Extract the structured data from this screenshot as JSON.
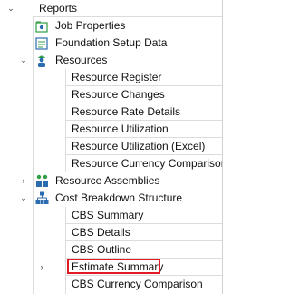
{
  "tree": {
    "root": {
      "label": "Reports",
      "expanded": true
    },
    "items": [
      {
        "label": "Job Properties"
      },
      {
        "label": "Foundation Setup Data"
      },
      {
        "label": "Resources",
        "expanded": true,
        "children": [
          "Resource Register",
          "Resource Changes",
          "Resource Rate Details",
          "Resource Utilization",
          "Resource Utilization (Excel)",
          "Resource Currency Comparison"
        ]
      },
      {
        "label": "Resource Assemblies",
        "expanded": false
      },
      {
        "label": "Cost Breakdown Structure",
        "expanded": true,
        "children": [
          "CBS Summary",
          "CBS Details",
          "CBS Outline",
          "Estimate Summary",
          "CBS Currency Comparison"
        ]
      }
    ],
    "selected": "Estimate Summary"
  },
  "colors": {
    "highlight_border": "#e01b24",
    "tree_lines": "#dcdcdc",
    "icon_blue": "#2b6cb0",
    "icon_green": "#2f9e44"
  },
  "icons": {
    "job_properties": "folder-gear-icon",
    "foundation_setup_data": "data-sheet-icon",
    "resources": "worker-icon",
    "resource_assemblies": "assembly-icon",
    "cost_breakdown_structure": "hierarchy-icon"
  }
}
